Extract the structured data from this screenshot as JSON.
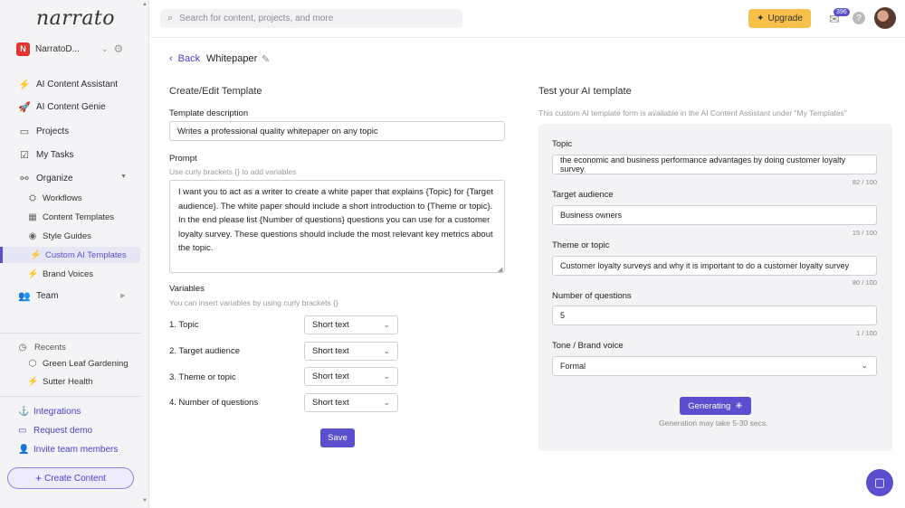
{
  "app": {
    "logo": "narrato"
  },
  "workspace": {
    "badge": "N",
    "name": "NarratoD..."
  },
  "sidebar": {
    "items": [
      {
        "label": "AI Content Assistant"
      },
      {
        "label": "AI Content Genie"
      },
      {
        "label": "Projects"
      },
      {
        "label": "My Tasks"
      },
      {
        "label": "Organize"
      }
    ],
    "organize": [
      {
        "label": "Workflows"
      },
      {
        "label": "Content Templates"
      },
      {
        "label": "Style Guides"
      },
      {
        "label": "Custom AI Templates"
      },
      {
        "label": "Brand Voices"
      }
    ],
    "team": {
      "label": "Team"
    },
    "recents": {
      "title": "Recents",
      "items": [
        {
          "label": "Green Leaf Gardening"
        },
        {
          "label": "Sutter Health"
        }
      ]
    },
    "links": [
      {
        "label": "Integrations"
      },
      {
        "label": "Request demo"
      },
      {
        "label": "Invite team members"
      }
    ],
    "create_button": "Create Content"
  },
  "header": {
    "search_placeholder": "Search for content, projects, and more",
    "upgrade": "Upgrade",
    "mail_count": "396",
    "help": "?"
  },
  "page": {
    "back": "Back",
    "title": "Whitepaper"
  },
  "editor": {
    "section_title": "Create/Edit Template",
    "description_label": "Template description",
    "description_value": "Writes a professional quality whitepaper on any topic",
    "prompt_label": "Prompt",
    "prompt_hint": "Use curly brackets {} to add variables",
    "prompt_value": "I want you to act as a writer to create a white paper that explains {Topic} for {Target audience}. The white paper should include a short introduction to {Theme or topic}. In the end please list {Number of questions} questions you can use for a customer loyalty survey. These questions should include the most relevant key metrics about the topic.",
    "variables_label": "Variables",
    "variables_hint": "You can insert variables by using curly brackets {}",
    "variables": [
      {
        "name": "1. Topic",
        "type": "Short text"
      },
      {
        "name": "2. Target audience",
        "type": "Short text"
      },
      {
        "name": "3. Theme or topic",
        "type": "Short text"
      },
      {
        "name": "4. Number of questions",
        "type": "Short text"
      }
    ],
    "save": "Save"
  },
  "tester": {
    "section_title": "Test your AI template",
    "note": "This custom AI template form is available in the AI Content Assistant under \"My Templates\"",
    "fields": [
      {
        "label": "Topic",
        "value": "the economic and business performance advantages by doing customer loyalty survey",
        "counter": "82 / 100"
      },
      {
        "label": "Target audience",
        "value": "Business owners",
        "counter": "15 / 100"
      },
      {
        "label": "Theme or topic",
        "value": "Customer loyalty surveys and why it is important to do a customer loyalty survey",
        "counter": "80 / 100"
      },
      {
        "label": "Number of questions",
        "value": "5",
        "counter": "1 / 100"
      }
    ],
    "tone_label": "Tone / Brand voice",
    "tone_value": "Formal",
    "generate": "Generating",
    "generate_note": "Generation may take 5-30 secs."
  },
  "colors": {
    "accent": "#5a4fcf",
    "upgrade": "#f7c04a",
    "workspace_badge": "#e3342f"
  }
}
